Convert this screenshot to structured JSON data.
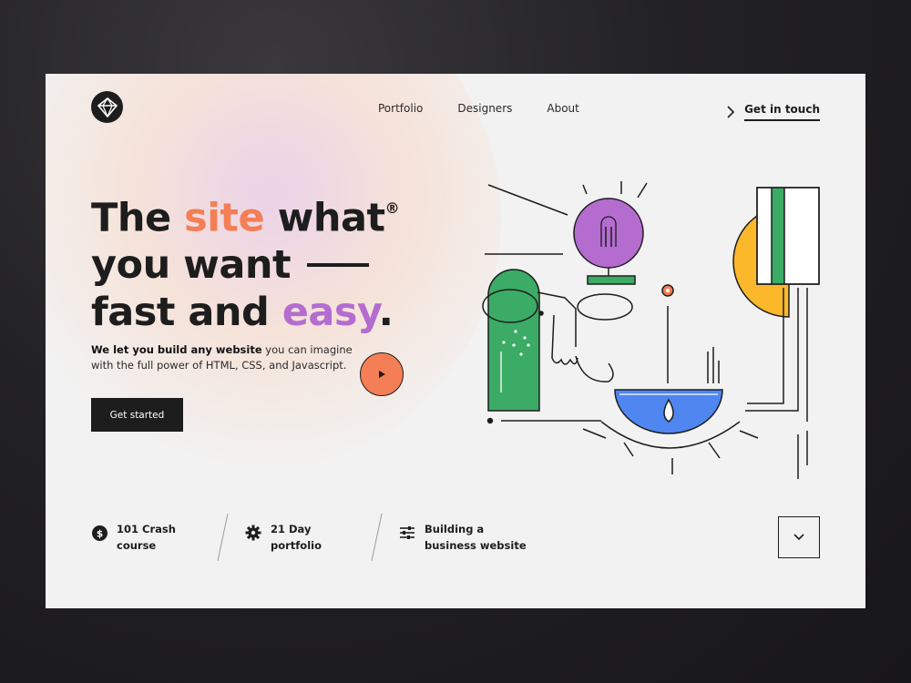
{
  "nav": {
    "items": [
      {
        "label": "Portfolio"
      },
      {
        "label": "Designers"
      },
      {
        "label": "About"
      }
    ],
    "cta_label": "Get in touch"
  },
  "hero": {
    "line1_a": "The",
    "line1_highlight": "site",
    "line1_b": "what",
    "line1_reg": "®",
    "line2": "you want",
    "line3_a": "fast and",
    "line3_highlight": "easy",
    "line3_period": ".",
    "sub_bold": "We let you build any website",
    "sub_rest": " you can imagine with the full power of HTML, CSS, and Javascript.",
    "button_label": "Get started"
  },
  "features": [
    {
      "icon": "dollar-icon",
      "line1": "101 Crash",
      "line2": "course"
    },
    {
      "icon": "gear-icon",
      "line1": "21 Day",
      "line2": "portfolio"
    },
    {
      "icon": "sliders-icon",
      "line1": "Building a",
      "line2": "business website"
    }
  ],
  "colors": {
    "accent_orange": "#f47e55",
    "accent_purple": "#b46ccf",
    "green": "#3bab65",
    "yellow": "#fbb82b",
    "blue": "#4f86f0",
    "dark": "#1d1d1d",
    "background": "#f2f2f2"
  }
}
